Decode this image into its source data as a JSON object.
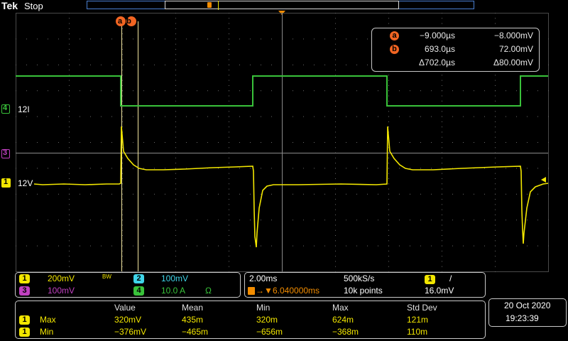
{
  "header": {
    "brand": "Tek",
    "status": "Stop"
  },
  "channels": {
    "ch4_label": "12I",
    "ch1_label": "12V",
    "ch4_number": "4",
    "ch3_number": "3",
    "ch1_number": "1"
  },
  "cursor_marker": "ab",
  "cursor_readout": {
    "a": {
      "id": "a",
      "time": "−9.000µs",
      "value": "−8.000mV"
    },
    "b": {
      "id": "b",
      "time": "693.0µs",
      "value": "72.00mV"
    },
    "delta": {
      "time": "Δ702.0µs",
      "value": "Δ80.00mV"
    }
  },
  "vertical_panel": {
    "ch1": {
      "num": "1",
      "scale": "200mV",
      "bw": "BW"
    },
    "ch2": {
      "num": "2",
      "scale": "100mV"
    },
    "ch3": {
      "num": "3",
      "scale": "100mV"
    },
    "ch4": {
      "num": "4",
      "scale": "10.0 A",
      "unit_icon": "Ω"
    }
  },
  "horizontal_panel": {
    "timebase": "2.00ms",
    "sample_rate": "500kS/s",
    "trigger_position": "6.040000ms",
    "record_length": "10k points",
    "trigger_source": "1",
    "trigger_slope": "/",
    "trigger_level": "16.0mV"
  },
  "measurements": {
    "headers": [
      "Value",
      "Mean",
      "Min",
      "Max",
      "Std Dev"
    ],
    "rows": [
      {
        "src": "1",
        "name": "Max",
        "value": "320mV",
        "mean": "435m",
        "min": "320m",
        "max": "624m",
        "std": "121m"
      },
      {
        "src": "1",
        "name": "Min",
        "value": "−376mV",
        "mean": "−465m",
        "min": "−656m",
        "max": "−368m",
        "std": "110m"
      }
    ]
  },
  "datetime": {
    "date": "20 Oct  2020",
    "time": "19:23:39"
  },
  "colors": {
    "ch1": "#f2e600",
    "ch2": "#3fd4e8",
    "ch3": "#c040c0",
    "ch4": "#39c23a",
    "cursor": "#f26522",
    "grid": "#5a5a5a"
  }
}
